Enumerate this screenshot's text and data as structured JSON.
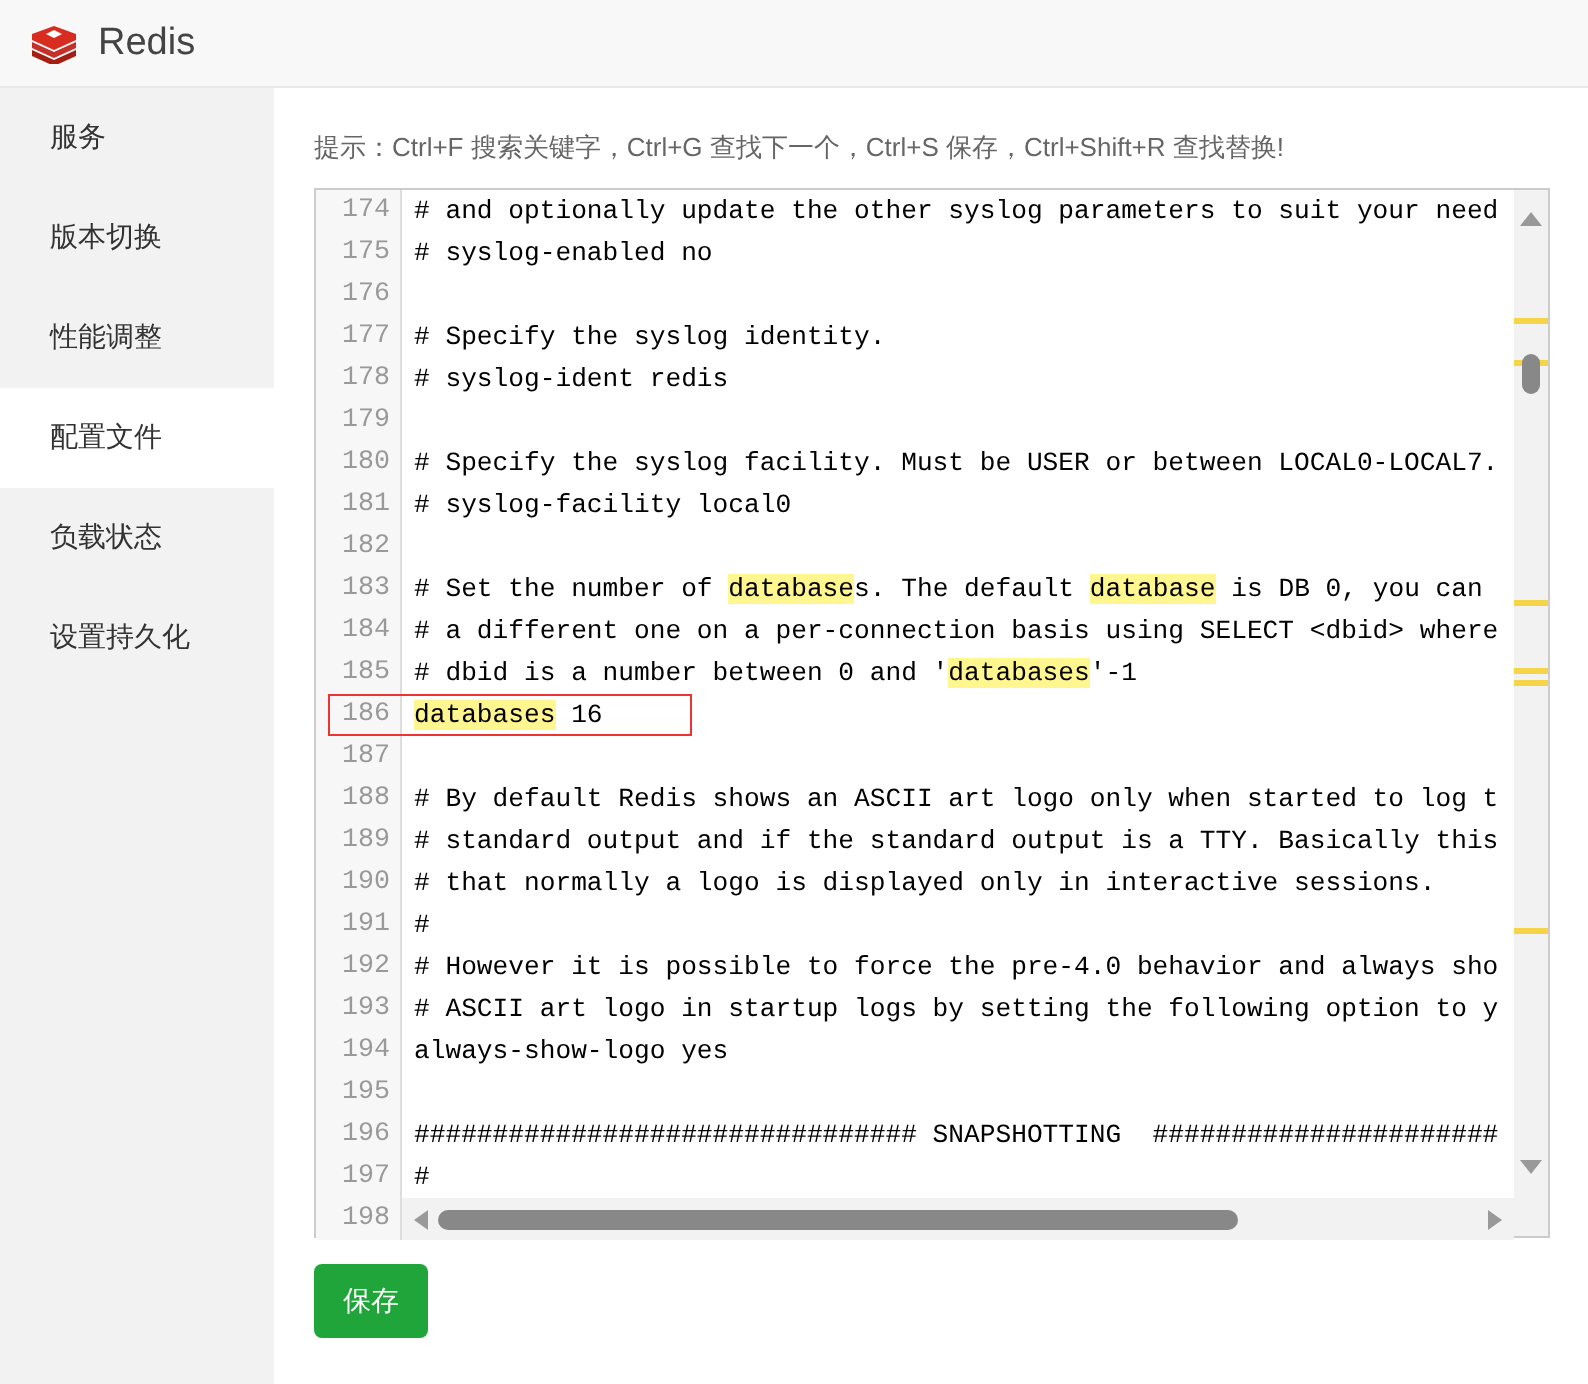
{
  "app": {
    "title": "Redis"
  },
  "sidebar": {
    "items": [
      {
        "label": "服务",
        "selected": false
      },
      {
        "label": "版本切换",
        "selected": false
      },
      {
        "label": "性能调整",
        "selected": false
      },
      {
        "label": "配置文件",
        "selected": true
      },
      {
        "label": "负载状态",
        "selected": false
      },
      {
        "label": "设置持久化",
        "selected": false
      }
    ]
  },
  "hint": "提示：Ctrl+F 搜索关键字，Ctrl+G 查找下一个，Ctrl+S 保存，Ctrl+Shift+R 查找替换!",
  "editor": {
    "lines": [
      {
        "number": "174",
        "boxed": false,
        "segments": [
          {
            "text": "# and optionally update the other syslog parameters to suit your need",
            "match": false
          }
        ]
      },
      {
        "number": "175",
        "boxed": false,
        "segments": [
          {
            "text": "# syslog-enabled no",
            "match": false
          }
        ]
      },
      {
        "number": "176",
        "boxed": false
      },
      {
        "number": "177",
        "boxed": false,
        "segments": [
          {
            "text": "# Specify the syslog identity.",
            "match": false
          }
        ]
      },
      {
        "number": "178",
        "boxed": false,
        "segments": [
          {
            "text": "# syslog-ident redis",
            "match": false
          }
        ]
      },
      {
        "number": "179",
        "boxed": false
      },
      {
        "number": "180",
        "boxed": false,
        "segments": [
          {
            "text": "# Specify the syslog facility. Must be USER or between LOCAL0-LOCAL7.",
            "match": false
          }
        ]
      },
      {
        "number": "181",
        "boxed": false,
        "segments": [
          {
            "text": "# syslog-facility local0",
            "match": false
          }
        ]
      },
      {
        "number": "182",
        "boxed": false
      },
      {
        "number": "183",
        "boxed": false,
        "segments": [
          {
            "text": "# Set the number of ",
            "match": false
          },
          {
            "text": "database",
            "match": true
          },
          {
            "text": "s. The default ",
            "match": false
          },
          {
            "text": "database",
            "match": true
          },
          {
            "text": " is DB 0, you can",
            "match": false
          }
        ]
      },
      {
        "number": "184",
        "boxed": false,
        "segments": [
          {
            "text": "# a different one on a per-connection basis using SELECT <dbid> where",
            "match": false
          }
        ]
      },
      {
        "number": "185",
        "boxed": false,
        "segments": [
          {
            "text": "# dbid is a number between 0 and '",
            "match": false
          },
          {
            "text": "databases",
            "match": true
          },
          {
            "text": "'-1",
            "match": false
          }
        ]
      },
      {
        "number": "186",
        "boxed": true,
        "segments": [
          {
            "text": "databases",
            "match": true
          },
          {
            "text": " 16",
            "match": false
          }
        ]
      },
      {
        "number": "187",
        "boxed": false
      },
      {
        "number": "188",
        "boxed": false,
        "segments": [
          {
            "text": "# By default Redis shows an ASCII art logo only when started to log t",
            "match": false
          }
        ]
      },
      {
        "number": "189",
        "boxed": false,
        "segments": [
          {
            "text": "# standard output and if the standard output is a TTY. Basically this",
            "match": false
          }
        ]
      },
      {
        "number": "190",
        "boxed": false,
        "segments": [
          {
            "text": "# that normally a logo is displayed only in interactive sessions.",
            "match": false
          }
        ]
      },
      {
        "number": "191",
        "boxed": false,
        "segments": [
          {
            "text": "#",
            "match": false
          }
        ]
      },
      {
        "number": "192",
        "boxed": false,
        "segments": [
          {
            "text": "# However it is possible to force the pre-4.0 behavior and always sho",
            "match": false
          }
        ]
      },
      {
        "number": "193",
        "boxed": false,
        "segments": [
          {
            "text": "# ASCII art logo in startup logs by setting the following option to y",
            "match": false
          }
        ]
      },
      {
        "number": "194",
        "boxed": false,
        "segments": [
          {
            "text": "always-show-logo yes",
            "match": false
          }
        ]
      },
      {
        "number": "195",
        "boxed": false
      },
      {
        "number": "196",
        "boxed": false,
        "segments": [
          {
            "text": "################################ SNAPSHOTTING  ######################",
            "match": false
          }
        ]
      },
      {
        "number": "197",
        "boxed": false,
        "segments": [
          {
            "text": "#",
            "match": false
          }
        ]
      }
    ],
    "last_line_number": "198"
  },
  "save_button": "保存"
}
